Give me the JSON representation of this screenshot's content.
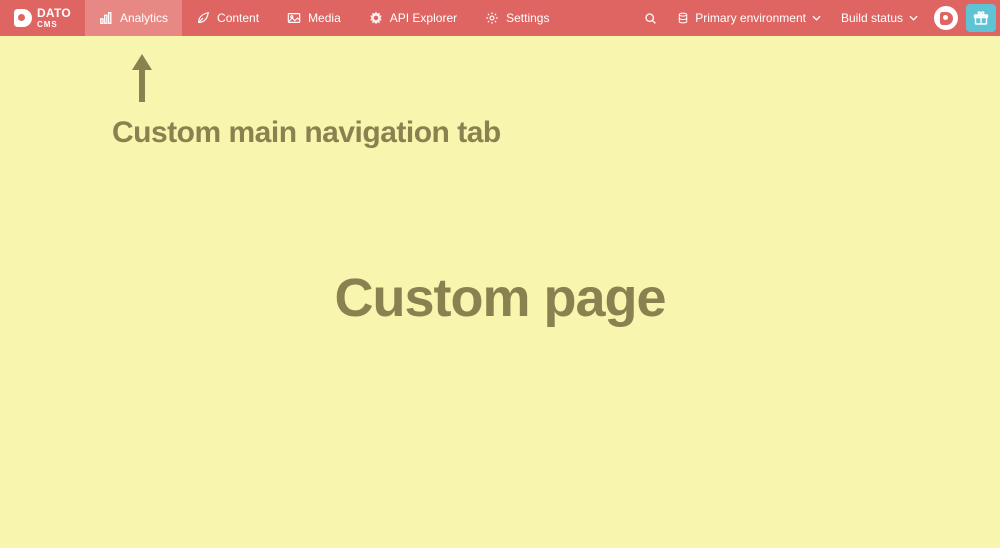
{
  "logo": {
    "line1": "DATO",
    "line2": "CMS"
  },
  "nav": {
    "items": [
      {
        "label": "Analytics",
        "active": true
      },
      {
        "label": "Content"
      },
      {
        "label": "Media"
      },
      {
        "label": "API Explorer"
      },
      {
        "label": "Settings"
      }
    ]
  },
  "right": {
    "environment_label": "Primary environment",
    "build_status_label": "Build status"
  },
  "annotation": {
    "arrow_label": "Custom main navigation tab"
  },
  "main": {
    "heading": "Custom page"
  },
  "colors": {
    "topbar": "#de6562",
    "topbar_active": "#e88885",
    "page_bg": "#f8f5ae",
    "annotation_fg": "#8a8151",
    "gift_bg": "#5fc3d6"
  }
}
